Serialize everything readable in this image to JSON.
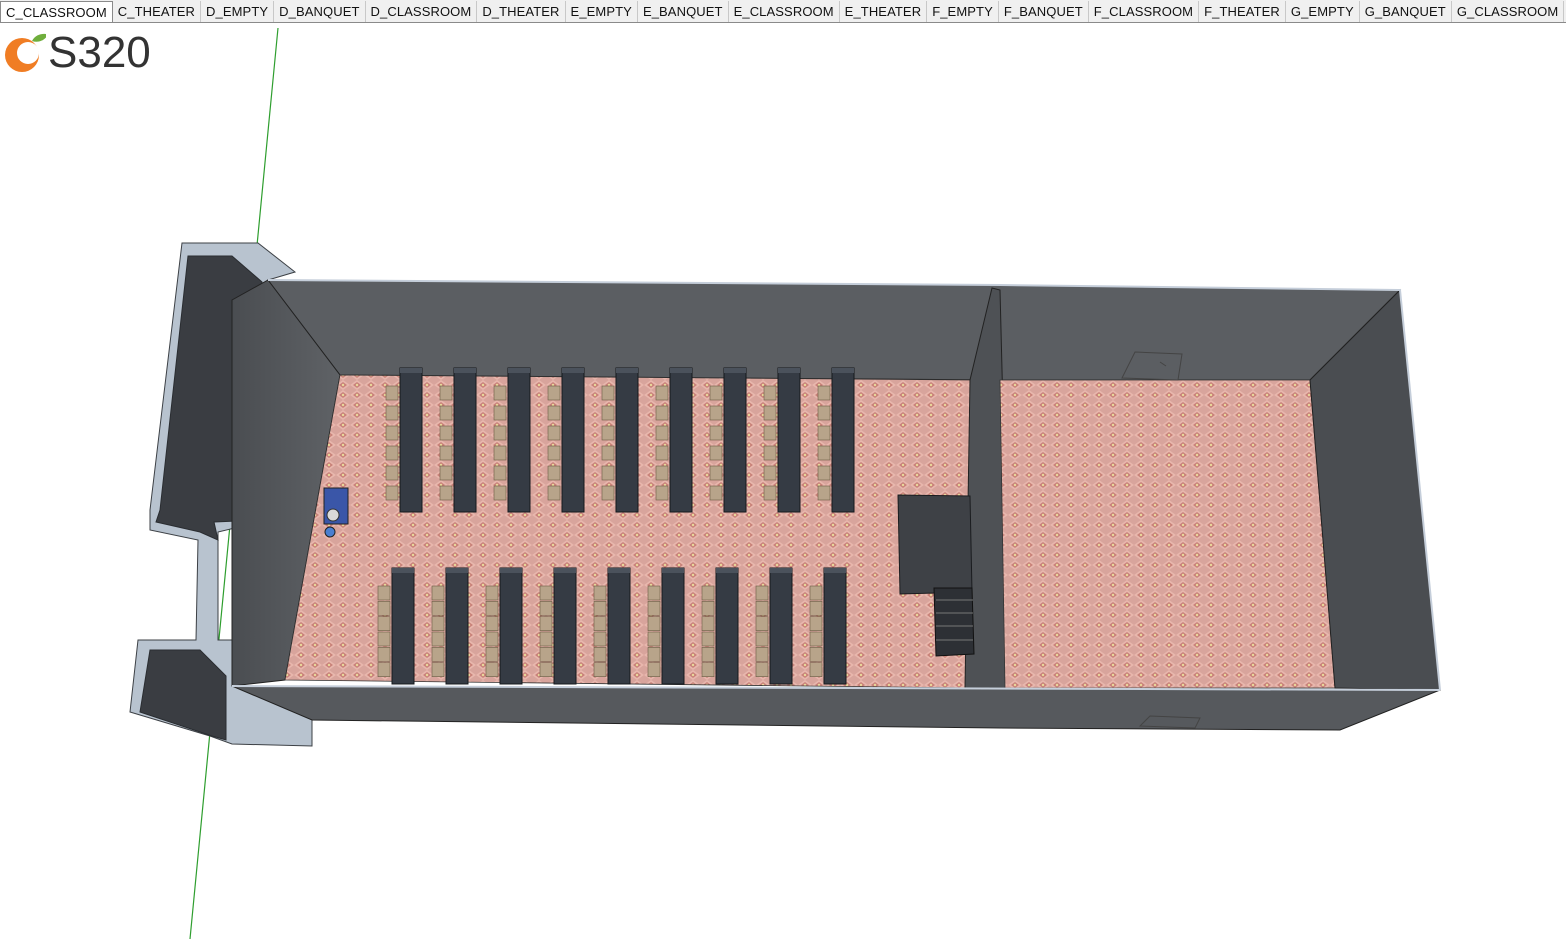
{
  "scene_tabs": [
    {
      "label": "C_CLASSROOM",
      "active": true
    },
    {
      "label": "C_THEATER",
      "active": false
    },
    {
      "label": "D_EMPTY",
      "active": false
    },
    {
      "label": "D_BANQUET",
      "active": false
    },
    {
      "label": "D_CLASSROOM",
      "active": false
    },
    {
      "label": "D_THEATER",
      "active": false
    },
    {
      "label": "E_EMPTY",
      "active": false
    },
    {
      "label": "E_BANQUET",
      "active": false
    },
    {
      "label": "E_CLASSROOM",
      "active": false
    },
    {
      "label": "E_THEATER",
      "active": false
    },
    {
      "label": "F_EMPTY",
      "active": false
    },
    {
      "label": "F_BANQUET",
      "active": false
    },
    {
      "label": "F_CLASSROOM",
      "active": false
    },
    {
      "label": "F_THEATER",
      "active": false
    },
    {
      "label": "G_EMPTY",
      "active": false
    },
    {
      "label": "G_BANQUET",
      "active": false
    },
    {
      "label": "G_CLASSROOM",
      "active": false
    }
  ],
  "logo": {
    "text": "S320",
    "icon": "orange-logo-icon",
    "icon_color": "#f07d24",
    "leaf_color": "#6fae3c"
  },
  "model": {
    "wall_color": "#5a5d60",
    "wall_edge_color": "#b9c4d0",
    "carpet_color": "#d49a92",
    "desk_color": "#353b44",
    "chair_color": "#b8a48a",
    "axis_color": "#2e9e2e",
    "desk_rows_per_block": 2,
    "desk_columns": 9
  }
}
